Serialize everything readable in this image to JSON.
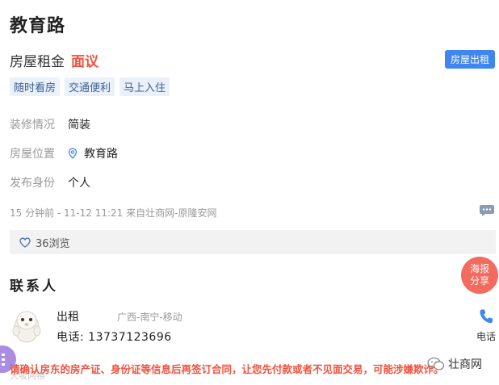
{
  "listing": {
    "title": "教育路",
    "rent_label": "房屋租金",
    "rent_value": "面议",
    "type_badge": "房屋出租",
    "tags": [
      "随时看房",
      "交通便利",
      "马上入住"
    ]
  },
  "details": {
    "decoration": {
      "label": "装修情况",
      "value": "简装"
    },
    "location": {
      "label": "房屋位置",
      "value": "教育路",
      "icon": "location-pin-icon"
    },
    "publisher": {
      "label": "发布身份",
      "value": "个人"
    }
  },
  "meta": {
    "posted": "15 分钟前 - 11-12 11:21 来自壮商网-原隆安网",
    "views": "36浏览"
  },
  "share": {
    "line1": "海报",
    "line2": "分享"
  },
  "contact": {
    "section_title": "联系人",
    "name": "出租",
    "region": "广西-南宁-移动",
    "phone": "电话: 13737123696",
    "call_label": "电话"
  },
  "warning": "请确认房东的房产证、身份证等信息后再签订合同，让您先付款或者不见面交易，可能涉嫌欺诈。",
  "watermark": "大吸网络",
  "brand": "壮商网",
  "colors": {
    "accent_red": "#f0513c",
    "badge_blue": "#3f86ef",
    "tag_bg": "#eaf1fb",
    "share_red": "#f36a5e",
    "fab_purple": "#a98de0"
  }
}
